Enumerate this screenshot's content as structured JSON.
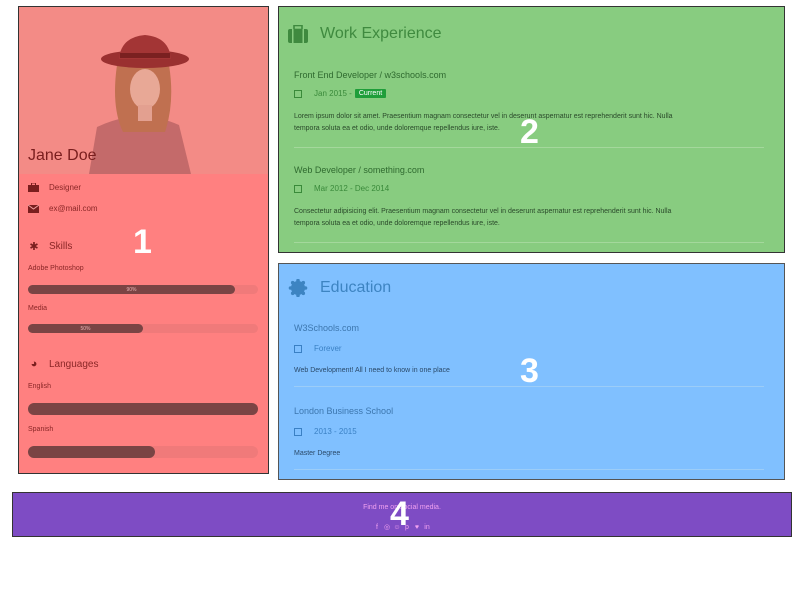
{
  "profile": {
    "name": "Jane Doe",
    "job": "Designer",
    "email": "ex@mail.com",
    "skills_title": "Skills",
    "skills": [
      {
        "name": "Adobe Photoshop",
        "percent": 90,
        "label": "90%"
      },
      {
        "name": "Media",
        "percent": 50,
        "label": "50%"
      }
    ],
    "languages_title": "Languages",
    "languages": [
      {
        "name": "English",
        "percent": 100
      },
      {
        "name": "Spanish",
        "percent": 55
      }
    ],
    "region_number": "1"
  },
  "work": {
    "title": "Work Experience",
    "icon": "suitcase-icon",
    "entries": [
      {
        "title": "Front End Developer / w3schools.com",
        "date": "Jan 2015 -",
        "badge": "Current",
        "text_line1": "Lorem ipsum dolor sit amet. Praesentium magnam consectetur vel in deserunt aspernatur est reprehenderit sunt hic. Nulla",
        "text_line2": "tempora soluta ea et odio, unde doloremque repellendus iure, iste."
      },
      {
        "title": "Web Developer / something.com",
        "date": "Mar 2012 - Dec 2014",
        "text_line1": "Consectetur adipisicing elit. Praesentium magnam consectetur vel in deserunt aspernatur est reprehenderit sunt hic. Nulla",
        "text_line2": "tempora soluta ea et odio, unde doloremque repellendus iure, iste."
      }
    ],
    "region_number": "2"
  },
  "education": {
    "title": "Education",
    "icon": "certificate-icon",
    "entries": [
      {
        "title": "W3Schools.com",
        "date": "Forever",
        "text": "Web Development! All I need to know in one place"
      },
      {
        "title": "London Business School",
        "date": "2013 - 2015",
        "text": "Master Degree"
      }
    ],
    "region_number": "3"
  },
  "footer": {
    "text": "Find me on social media.",
    "social_icons": [
      "facebook-icon",
      "instagram-icon",
      "snapchat-icon",
      "pinterest-icon",
      "twitter-icon",
      "linkedin-icon"
    ],
    "social_glyphs": [
      "f",
      "◎",
      "☺",
      "p",
      "♥",
      "in"
    ],
    "region_number": "4"
  },
  "colors": {
    "profile_bg": "#ff8080",
    "work_bg": "#88cc80",
    "education_bg": "#80c0ff",
    "footer_bg": "#7e4cc4",
    "badge": "#1f9e3a"
  }
}
